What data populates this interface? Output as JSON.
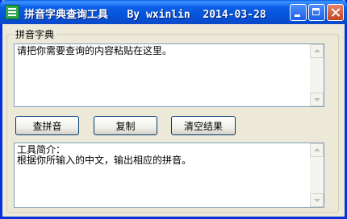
{
  "window": {
    "title": "拼音字典查询工具   By wxinlin  2014-03-28"
  },
  "group": {
    "label": "拼音字典"
  },
  "input_area": {
    "text": "请把你需要查询的内容粘贴在这里。"
  },
  "buttons": {
    "query": "查拼音",
    "copy": "复制",
    "clear": "清空结果"
  },
  "output_area": {
    "text": "工具简介：\n根据你所输入的中文，输出相应的拼音。"
  },
  "icons": [
    "app-icon",
    "minimize-icon",
    "maximize-icon",
    "close-icon",
    "scroll-up-icon",
    "scroll-down-icon"
  ]
}
